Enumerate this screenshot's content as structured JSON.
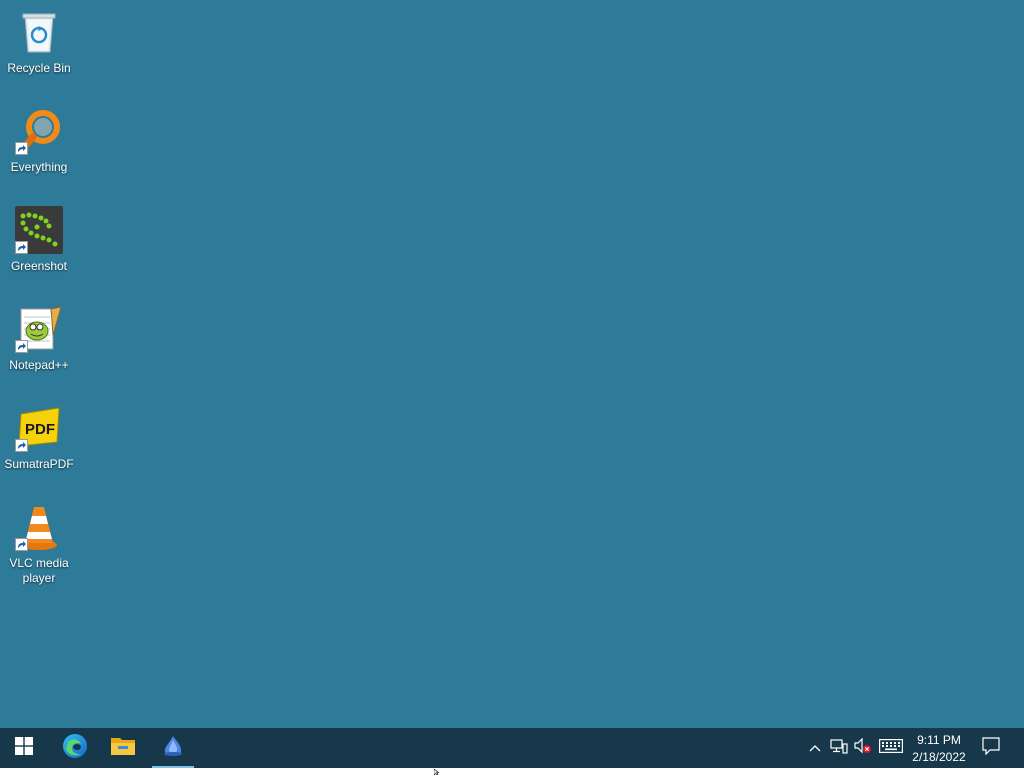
{
  "desktop": {
    "background_color": "#2e7b99",
    "icons": [
      {
        "label": "Recycle Bin",
        "icon": "recycle-bin-icon",
        "shortcut": false
      },
      {
        "label": "Everything",
        "icon": "everything-search-icon",
        "shortcut": true
      },
      {
        "label": "Greenshot",
        "icon": "greenshot-icon",
        "shortcut": true
      },
      {
        "label": "Notepad++",
        "icon": "notepad-plus-plus-icon",
        "shortcut": true
      },
      {
        "label": "SumatraPDF",
        "icon": "sumatrapdf-icon",
        "shortcut": true
      },
      {
        "label": "VLC media player",
        "icon": "vlc-icon",
        "shortcut": true
      }
    ]
  },
  "taskbar": {
    "background_color": "#17384a",
    "start": {
      "icon": "windows-start-icon"
    },
    "pinned": [
      {
        "icon": "edge-icon",
        "active": false
      },
      {
        "icon": "file-explorer-icon",
        "active": false
      },
      {
        "icon": "app-icon",
        "active": true
      }
    ],
    "tray": {
      "icons": [
        "show-hidden-icons-chevron-icon",
        "network-icon",
        "volume-muted-icon",
        "keyboard-icon"
      ],
      "time": "9:11 PM",
      "date": "2/18/2022"
    },
    "notifications": {
      "icon": "action-center-icon"
    }
  }
}
